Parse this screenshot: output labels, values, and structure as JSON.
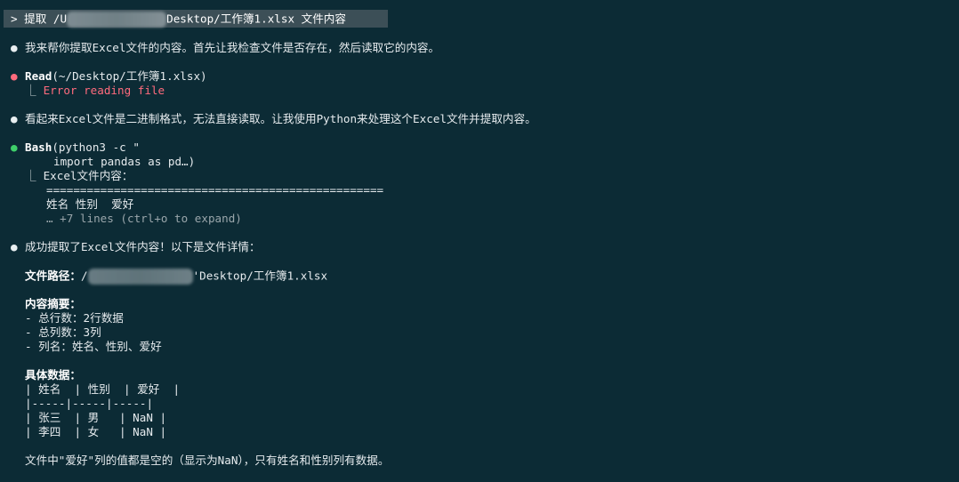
{
  "prompt": {
    "prefix": "> 提取 /U",
    "suffix": "Desktop/工作簿1.xlsx 文件内容"
  },
  "bullets": {
    "white": "●",
    "red": "●",
    "green": "●",
    "tree": "⎿"
  },
  "messages": {
    "m1": "我来帮你提取Excel文件的内容。首先让我检查文件是否存在，然后读取它的内容。",
    "m2": "看起来Excel文件是二进制格式，无法直接读取。让我使用Python来处理这个Excel文件并提取内容。",
    "m3": "成功提取了Excel文件内容！以下是文件详情："
  },
  "read_tool": {
    "name": "Read",
    "args": "(~/Desktop/工作簿1.xlsx)",
    "error": "Error reading file"
  },
  "bash_tool": {
    "name": "Bash",
    "args_line1": "(python3 -c \"",
    "args_line2": "import pandas as pd…)",
    "out_line1": "Excel文件内容：",
    "out_line2": "==================================================",
    "out_line3": "姓名 性别  爱好",
    "collapsed": "… +7 lines (ctrl+o to expand)"
  },
  "details": {
    "path_label": "文件路径：",
    "path_prefix": "/",
    "path_suffix": "'Desktop/工作簿1.xlsx",
    "summary_title": "内容摘要：",
    "summary_items": [
      "- 总行数：2行数据",
      "- 总列数：3列",
      "- 列名：姓名、性别、爱好"
    ],
    "data_title": "具体数据：",
    "table_lines": [
      "| 姓名  | 性别  | 爱好  |",
      "|-----|-----|-----|",
      "| 张三  | 男   | NaN |",
      "| 李四  | 女   | NaN |"
    ],
    "footer": "文件中\"爱好\"列的值都是空的（显示为NaN），只有姓名和性别列有数据。"
  }
}
